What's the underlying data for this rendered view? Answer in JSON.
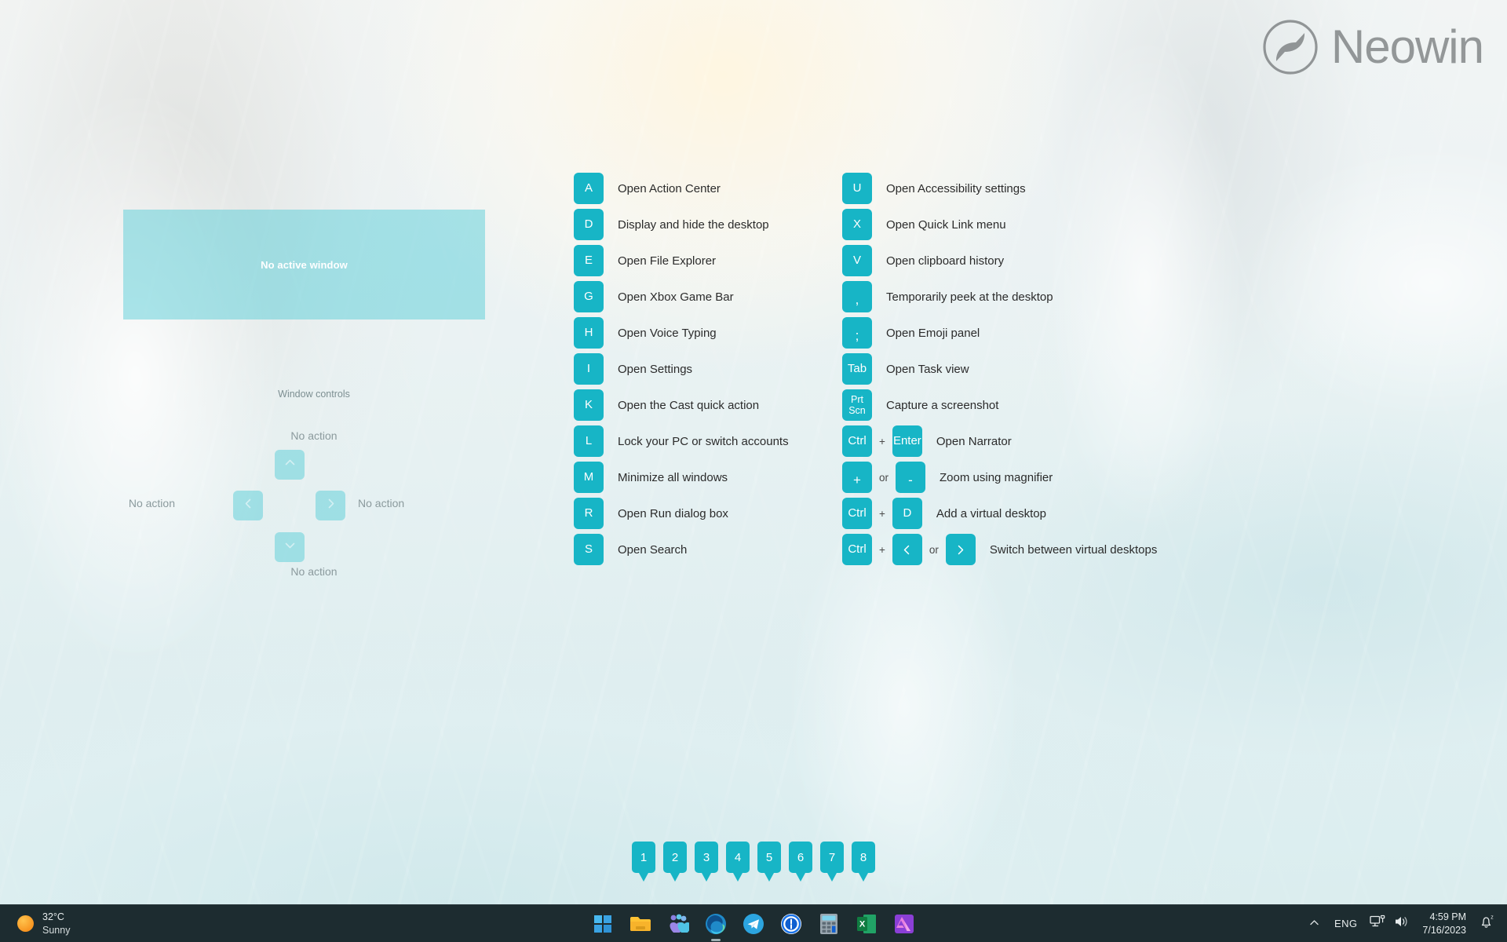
{
  "branding": {
    "logo_text": "Neowin",
    "logo_icon": "neowin-logo-icon"
  },
  "active_window": {
    "label": "No active window"
  },
  "window_controls": {
    "title": "Window controls",
    "up": {
      "icon": "chevron-up-icon",
      "label": "No action"
    },
    "down": {
      "icon": "chevron-down-icon",
      "label": "No action"
    },
    "left": {
      "icon": "chevron-left-icon",
      "label": "No action"
    },
    "right": {
      "icon": "chevron-right-icon",
      "label": "No action"
    }
  },
  "shortcuts": {
    "left_column": [
      {
        "keys": [
          "A"
        ],
        "desc": "Open Action Center"
      },
      {
        "keys": [
          "D"
        ],
        "desc": "Display and hide the desktop"
      },
      {
        "keys": [
          "E"
        ],
        "desc": "Open File Explorer"
      },
      {
        "keys": [
          "G"
        ],
        "desc": "Open Xbox Game Bar"
      },
      {
        "keys": [
          "H"
        ],
        "desc": "Open Voice Typing"
      },
      {
        "keys": [
          "I"
        ],
        "desc": "Open Settings"
      },
      {
        "keys": [
          "K"
        ],
        "desc": "Open the Cast quick action"
      },
      {
        "keys": [
          "L"
        ],
        "desc": "Lock your PC or switch accounts"
      },
      {
        "keys": [
          "M"
        ],
        "desc": "Minimize all windows"
      },
      {
        "keys": [
          "R"
        ],
        "desc": "Open Run dialog box"
      },
      {
        "keys": [
          "S"
        ],
        "desc": "Open Search"
      }
    ],
    "right_column": [
      {
        "keys": [
          "U"
        ],
        "desc": "Open Accessibility settings"
      },
      {
        "keys": [
          "X"
        ],
        "desc": "Open Quick Link menu"
      },
      {
        "keys": [
          "V"
        ],
        "desc": "Open clipboard history"
      },
      {
        "keys": [
          ","
        ],
        "desc": "Temporarily peek at the desktop"
      },
      {
        "keys": [
          ";"
        ],
        "desc": "Open Emoji panel"
      },
      {
        "keys": [
          "Tab"
        ],
        "desc": "Open Task view"
      },
      {
        "keys": [
          "Prt Scn"
        ],
        "desc": "Capture a screenshot"
      },
      {
        "keys": [
          "Ctrl",
          "Enter"
        ],
        "joiners": [
          "+"
        ],
        "desc": "Open Narrator"
      },
      {
        "keys": [
          "+",
          "-"
        ],
        "joiners": [
          "or"
        ],
        "desc": "Zoom using magnifier"
      },
      {
        "keys": [
          "Ctrl",
          "D"
        ],
        "joiners": [
          "+"
        ],
        "desc": "Add a virtual desktop"
      },
      {
        "keys": [
          "Ctrl",
          "<",
          ">"
        ],
        "joiners": [
          "+",
          "or"
        ],
        "desc": "Switch between virtual desktops"
      }
    ]
  },
  "number_badges": [
    "1",
    "2",
    "3",
    "4",
    "5",
    "6",
    "7",
    "8"
  ],
  "taskbar": {
    "weather": {
      "temperature": "32°C",
      "condition": "Sunny",
      "icon": "sun-icon"
    },
    "apps": [
      {
        "name": "start-button",
        "icon": "windows-logo-icon"
      },
      {
        "name": "file-explorer",
        "icon": "folder-icon"
      },
      {
        "name": "widgets",
        "icon": "widgets-icon"
      },
      {
        "name": "microsoft-edge",
        "icon": "edge-icon",
        "running": true
      },
      {
        "name": "telegram",
        "icon": "telegram-icon"
      },
      {
        "name": "one-password",
        "icon": "1password-icon"
      },
      {
        "name": "calculator",
        "icon": "calculator-icon"
      },
      {
        "name": "microsoft-excel",
        "icon": "excel-icon"
      },
      {
        "name": "affinity-photo",
        "icon": "affinity-icon"
      }
    ],
    "tray": {
      "overflow_icon": "chevron-up-icon",
      "language": "ENG",
      "network_icon": "network-icon",
      "volume_icon": "volume-icon",
      "time": "4:59 PM",
      "date": "7/16/2023",
      "notifications_icon": "bell-sleep-icon"
    }
  },
  "colors": {
    "key_tile": "#17b5c6",
    "key_tile_faded": "rgba(73,202,212,0.45)",
    "taskbar": "#1d2c30",
    "text_primary": "#2b2b2b",
    "text_muted": "#8b9a9d"
  }
}
